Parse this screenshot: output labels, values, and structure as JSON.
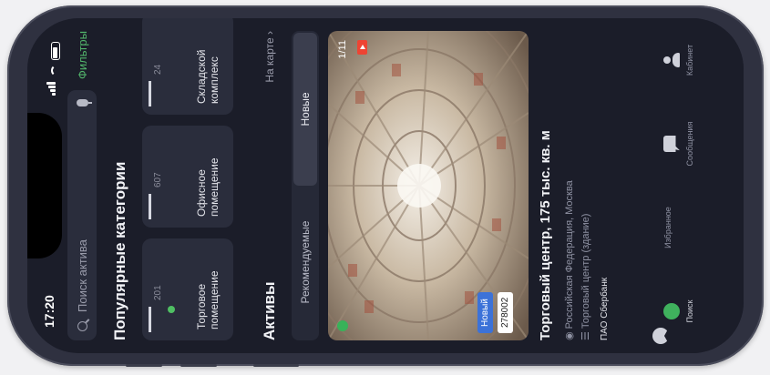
{
  "status": {
    "time": "17:20"
  },
  "search": {
    "placeholder": "Поиск актива",
    "filters_label": "Фильтры"
  },
  "categories": {
    "title": "Популярные категории",
    "items": [
      {
        "count": "201",
        "label": "Торговое помещение",
        "icon": "shop-building-icon"
      },
      {
        "count": "607",
        "label": "Офисное помещение",
        "icon": "office-building-icon"
      },
      {
        "count": "24",
        "label": "Складской комплекс",
        "icon": "warehouse-icon"
      }
    ]
  },
  "assets": {
    "title": "Активы",
    "map_link": "На карте",
    "tabs": [
      {
        "label": "Рекомендуемые",
        "active": false
      },
      {
        "label": "Новые",
        "active": true
      }
    ]
  },
  "card": {
    "id": "278002",
    "badge": "Новый",
    "counter": "1/11",
    "title": "Торговый центр, 175 тыс. кв. м",
    "location": "Российская Федерация, Москва",
    "type": "Торговый центр (здание)",
    "owner": "ПАО Сбербанк"
  },
  "tabbar": {
    "items": [
      {
        "label": "Поиск",
        "icon": "search-icon",
        "active": true
      },
      {
        "label": "Избранное",
        "icon": "bookmark-icon",
        "active": false
      },
      {
        "label": "Сообщения",
        "icon": "chat-icon",
        "active": false
      },
      {
        "label": "Кабинет",
        "icon": "profile-icon",
        "active": false
      }
    ]
  },
  "colors": {
    "accent_green": "#4fbf63",
    "badge_blue": "#3c72d8",
    "background": "#1b1d29",
    "surface": "#2a2d3c"
  }
}
